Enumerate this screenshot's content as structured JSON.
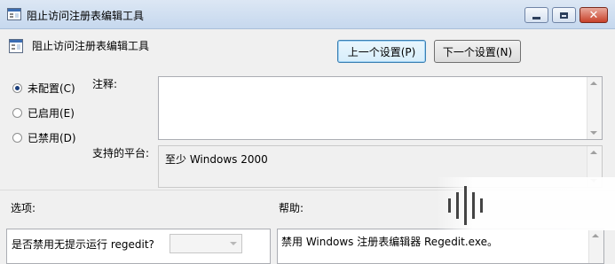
{
  "window": {
    "title": "阻止访问注册表编辑工具"
  },
  "header": {
    "title": "阻止访问注册表编辑工具"
  },
  "nav": {
    "prev_label": "上一个设置(P)",
    "next_label": "下一个设置(N)"
  },
  "radios": [
    {
      "label": "未配置(C)",
      "selected": true
    },
    {
      "label": "已启用(E)",
      "selected": false
    },
    {
      "label": "已禁用(D)",
      "selected": false
    }
  ],
  "comment": {
    "label": "注释:",
    "value": ""
  },
  "platform": {
    "label": "支持的平台:",
    "value": "至少 Windows 2000"
  },
  "options": {
    "label": "选项:",
    "question": "是否禁用无提示运行 regedit?",
    "dropdown_value": ""
  },
  "help": {
    "label": "帮助:",
    "text": "禁用 Windows 注册表编辑器 Regedit.exe。"
  }
}
